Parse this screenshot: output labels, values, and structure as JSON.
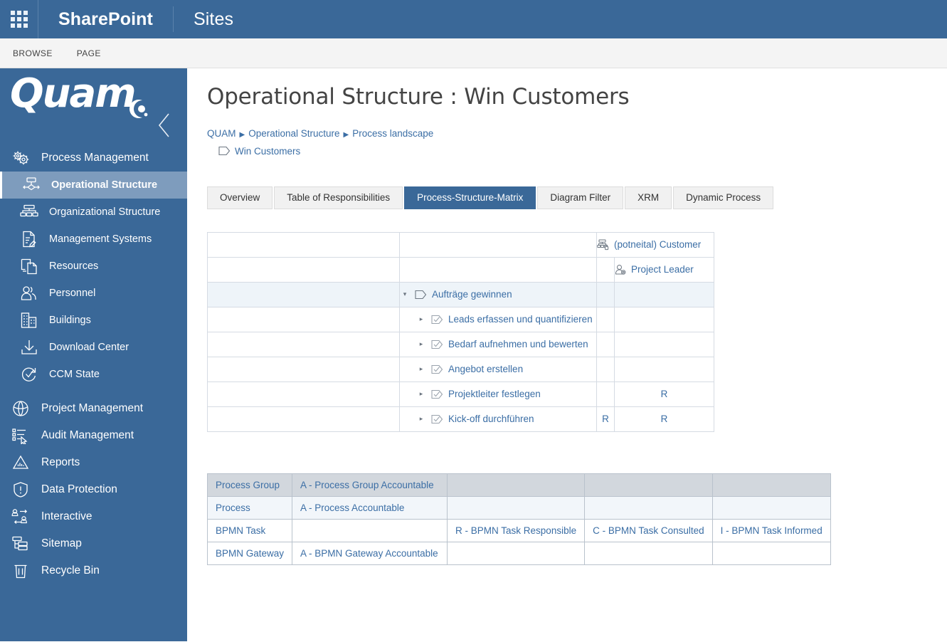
{
  "suitebar": {
    "app_launcher": "app-launcher",
    "brand": "SharePoint",
    "site": "Sites"
  },
  "ribbon": {
    "tabs": [
      "BROWSE",
      "PAGE"
    ]
  },
  "sidebar": {
    "logo_text": "Quam",
    "collapse_label": "chevron-left",
    "items": [
      {
        "label": "Process Management",
        "icon": "gears-icon",
        "level": "group",
        "active": false
      },
      {
        "label": "Operational Structure",
        "icon": "process-flow-icon",
        "level": "sub",
        "active": true
      },
      {
        "label": "Organizational Structure",
        "icon": "org-chart-icon",
        "level": "sub",
        "active": false
      },
      {
        "label": "Management Systems",
        "icon": "document-pen-icon",
        "level": "sub",
        "active": false
      },
      {
        "label": "Resources",
        "icon": "resources-icon",
        "level": "sub",
        "active": false
      },
      {
        "label": "Personnel",
        "icon": "people-icon",
        "level": "sub",
        "active": false
      },
      {
        "label": "Buildings",
        "icon": "building-icon",
        "level": "sub",
        "active": false
      },
      {
        "label": "Download Center",
        "icon": "download-icon",
        "level": "sub",
        "active": false
      },
      {
        "label": "CCM State",
        "icon": "ccm-check-icon",
        "level": "sub",
        "active": false
      },
      {
        "label": "Project Management",
        "icon": "globe-icon",
        "level": "group",
        "active": false
      },
      {
        "label": "Audit Management",
        "icon": "audit-list-icon",
        "level": "group",
        "active": false
      },
      {
        "label": "Reports",
        "icon": "report-chart-icon",
        "level": "group",
        "active": false
      },
      {
        "label": "Data Protection",
        "icon": "shield-alert-icon",
        "level": "group",
        "active": false
      },
      {
        "label": "Interactive",
        "icon": "interactive-icon",
        "level": "group",
        "active": false
      },
      {
        "label": "Sitemap",
        "icon": "sitemap-icon",
        "level": "group",
        "active": false
      },
      {
        "label": "Recycle Bin",
        "icon": "trash-icon",
        "level": "group",
        "active": false
      }
    ]
  },
  "page": {
    "title": "Operational Structure : Win Customers",
    "breadcrumb": [
      "QUAM",
      "Operational Structure",
      "Process landscape"
    ],
    "breadcrumb_current": "Win Customers",
    "breadcrumb_current_icon": "process-pentagon-icon"
  },
  "tabs": [
    {
      "label": "Overview",
      "active": false
    },
    {
      "label": "Table of Responsibilities",
      "active": false
    },
    {
      "label": "Process-Structure-Matrix",
      "active": true
    },
    {
      "label": "Diagram Filter",
      "active": false
    },
    {
      "label": "XRM",
      "active": false
    },
    {
      "label": "Dynamic Process",
      "active": false
    }
  ],
  "matrix": {
    "col_header_org": {
      "label": "(potneital) Customer",
      "icon": "org-unit-icon"
    },
    "col_header_role": {
      "label": "Project Leader",
      "icon": "role-person-icon"
    },
    "rows": [
      {
        "label": "Aufträge gewinnen",
        "icon": "process-pentagon-icon",
        "twisty": "▾",
        "group": true,
        "c1": "",
        "c2": ""
      },
      {
        "label": "Leads erfassen und quantifizieren",
        "icon": "bpmn-task-icon",
        "twisty": "▸",
        "group": false,
        "c1": "",
        "c2": ""
      },
      {
        "label": "Bedarf aufnehmen und bewerten",
        "icon": "bpmn-task-icon",
        "twisty": "▸",
        "group": false,
        "c1": "",
        "c2": ""
      },
      {
        "label": "Angebot erstellen",
        "icon": "bpmn-task-icon",
        "twisty": "▸",
        "group": false,
        "c1": "",
        "c2": ""
      },
      {
        "label": "Projektleiter festlegen",
        "icon": "bpmn-task-icon",
        "twisty": "▸",
        "group": false,
        "c1": "",
        "c2": "R"
      },
      {
        "label": "Kick-off durchführen",
        "icon": "bpmn-task-icon",
        "twisty": "▸",
        "group": false,
        "c1": "R",
        "c2": "R"
      }
    ]
  },
  "legend": {
    "rows": [
      {
        "type": "Process Group",
        "c1": "A - Process Group Accountable",
        "c2": "",
        "c3": "",
        "c4": ""
      },
      {
        "type": "Process",
        "c1": "A - Process Accountable",
        "c2": "",
        "c3": "",
        "c4": ""
      },
      {
        "type": "BPMN Task",
        "c1": "",
        "c2": "R - BPMN Task Responsible",
        "c3": "C - BPMN Task Consulted",
        "c4": "I - BPMN Task Informed"
      },
      {
        "type": "BPMN Gateway",
        "c1": "A - BPMN Gateway Accountable",
        "c2": "",
        "c3": "",
        "c4": ""
      }
    ]
  },
  "colors": {
    "brand_blue": "#3a6898",
    "active_nav": "#7e9cbd",
    "link_blue": "#3b6ea5",
    "ribbon_bg": "#f4f4f4",
    "legend_header": "#d2d7dd",
    "legend_alt": "#f2f6fa",
    "group_row": "#eef4f9"
  }
}
